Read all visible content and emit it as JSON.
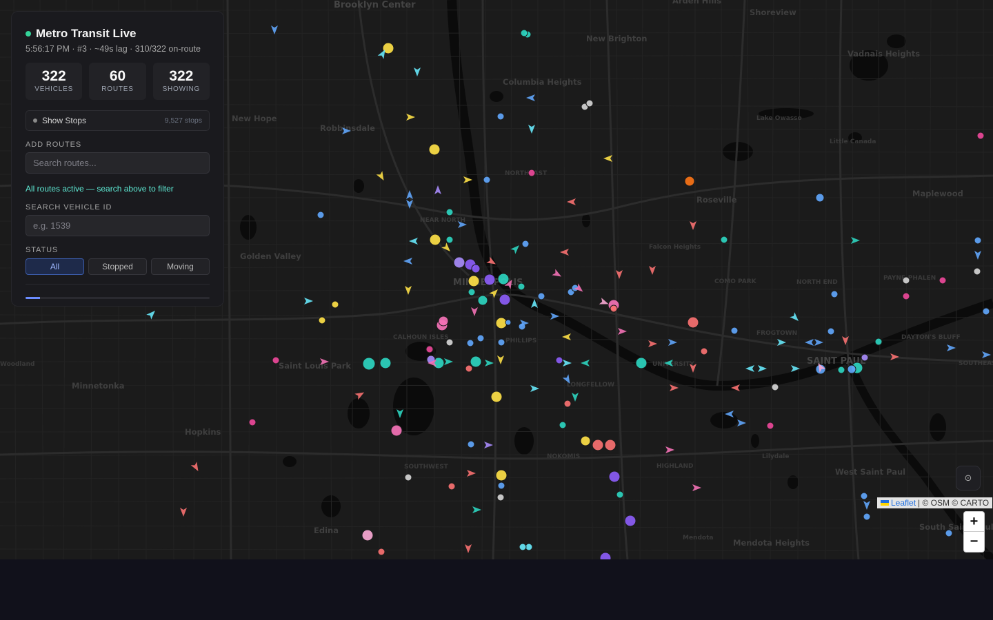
{
  "app": {
    "title": "Metro Transit Live",
    "subtitle": "5:56:17 PM · #3 · ~49s lag · 310/322 on-route",
    "status_color": "#34d399"
  },
  "stats": [
    {
      "value": "322",
      "label": "VEHICLES"
    },
    {
      "value": "60",
      "label": "ROUTES"
    },
    {
      "value": "322",
      "label": "SHOWING"
    }
  ],
  "stops_toggle": {
    "label": "Show Stops",
    "count": "9,527 stops"
  },
  "add_routes": {
    "label": "ADD ROUTES",
    "placeholder": "Search routes..."
  },
  "routes_note": "All routes active — search above to filter",
  "vehicle_search": {
    "label": "SEARCH VEHICLE ID",
    "placeholder": "e.g. 1539"
  },
  "status": {
    "label": "STATUS",
    "options": [
      "All",
      "Stopped",
      "Moving"
    ],
    "selected": "All"
  },
  "progress": {
    "fraction": 0.08
  },
  "map": {
    "attribution": {
      "leaflet": "Leaflet",
      "rest": "| © OSM © CARTO"
    },
    "zoom_in": "+",
    "zoom_out": "−",
    "locate_icon": "target-icon",
    "places": [
      {
        "name": "Brooklyn Center"
      },
      {
        "name": "Arden Hills"
      },
      {
        "name": "Shoreview"
      },
      {
        "name": "New Brighton"
      },
      {
        "name": "Vadnais Heights"
      },
      {
        "name": "Columbia Heights"
      },
      {
        "name": "New Hope"
      },
      {
        "name": "Robbinsdale"
      },
      {
        "name": "Lake Owasso"
      },
      {
        "name": "Little Canada"
      },
      {
        "name": "Roseville"
      },
      {
        "name": "Maplewood"
      },
      {
        "name": "NORTHEAST"
      },
      {
        "name": "NEAR NORTH"
      },
      {
        "name": "Golden Valley"
      },
      {
        "name": "Falcon Heights"
      },
      {
        "name": "MINNEAPOLIS"
      },
      {
        "name": "COMO PARK"
      },
      {
        "name": "NORTH END"
      },
      {
        "name": "PAYNE-PHALEN"
      },
      {
        "name": "FROGTOWN"
      },
      {
        "name": "DAYTON'S BLUFF"
      },
      {
        "name": "CALHOUN ISLES"
      },
      {
        "name": "PHILLIPS"
      },
      {
        "name": "Saint Louis Park"
      },
      {
        "name": "Minnetonka"
      },
      {
        "name": "UNIVERSITY"
      },
      {
        "name": "SAINT PAUL"
      },
      {
        "name": "SOUTHEAST"
      },
      {
        "name": "LONGFELLOW"
      },
      {
        "name": "Hopkins"
      },
      {
        "name": "NOKOMIS"
      },
      {
        "name": "Lilydale"
      },
      {
        "name": "HIGHLAND"
      },
      {
        "name": "SOUTHWEST"
      },
      {
        "name": "West Saint Paul"
      },
      {
        "name": "Edina"
      },
      {
        "name": "Mendota"
      },
      {
        "name": "Mendota Heights"
      },
      {
        "name": "South Saint Paul"
      },
      {
        "name": "Woodland"
      }
    ]
  }
}
